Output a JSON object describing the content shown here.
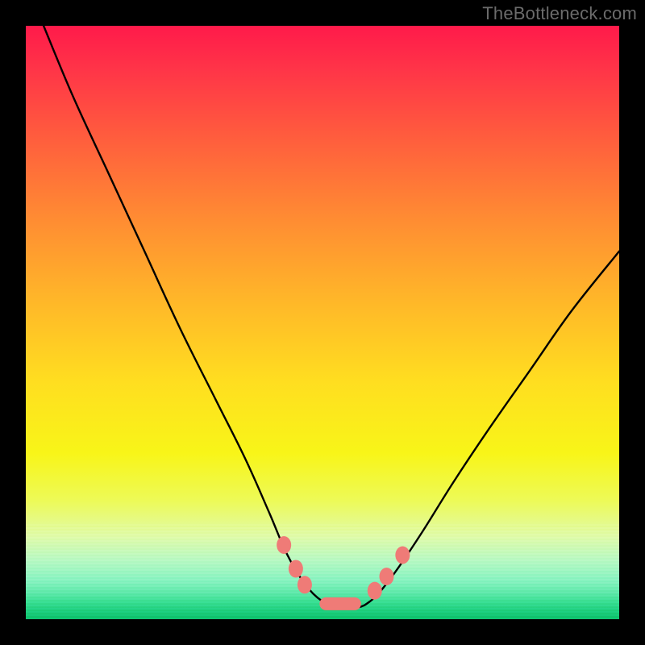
{
  "watermark": "TheBottleneck.com",
  "chart_data": {
    "type": "line",
    "title": "",
    "xlabel": "",
    "ylabel": "",
    "xlim": [
      0,
      100
    ],
    "ylim": [
      0,
      100
    ],
    "grid": false,
    "legend": false,
    "series": [
      {
        "name": "curve",
        "x": [
          3,
          8,
          14,
          20,
          26,
          32,
          37,
          41,
          44,
          47,
          50,
          53,
          56,
          58,
          60,
          63,
          67,
          72,
          78,
          85,
          92,
          100
        ],
        "y": [
          100,
          88,
          75,
          62,
          49,
          37,
          27,
          18,
          11,
          6,
          3,
          2,
          2,
          3,
          5,
          9,
          15,
          23,
          32,
          42,
          52,
          62
        ]
      }
    ],
    "markers": [
      {
        "name": "left-dot-upper",
        "x": 43.5,
        "y": 12.5
      },
      {
        "name": "left-dot-mid",
        "x": 45.5,
        "y": 8.5
      },
      {
        "name": "left-dot-lower",
        "x": 47.0,
        "y": 5.8
      },
      {
        "name": "trough-pill",
        "x0": 49.5,
        "x1": 56.5,
        "y": 2.6
      },
      {
        "name": "right-dot-lower",
        "x": 58.8,
        "y": 4.8
      },
      {
        "name": "right-dot-mid",
        "x": 60.8,
        "y": 7.2
      },
      {
        "name": "right-dot-upper",
        "x": 63.5,
        "y": 10.8
      }
    ],
    "marker_color": "#ef7b77",
    "curve_color": "#000000"
  }
}
